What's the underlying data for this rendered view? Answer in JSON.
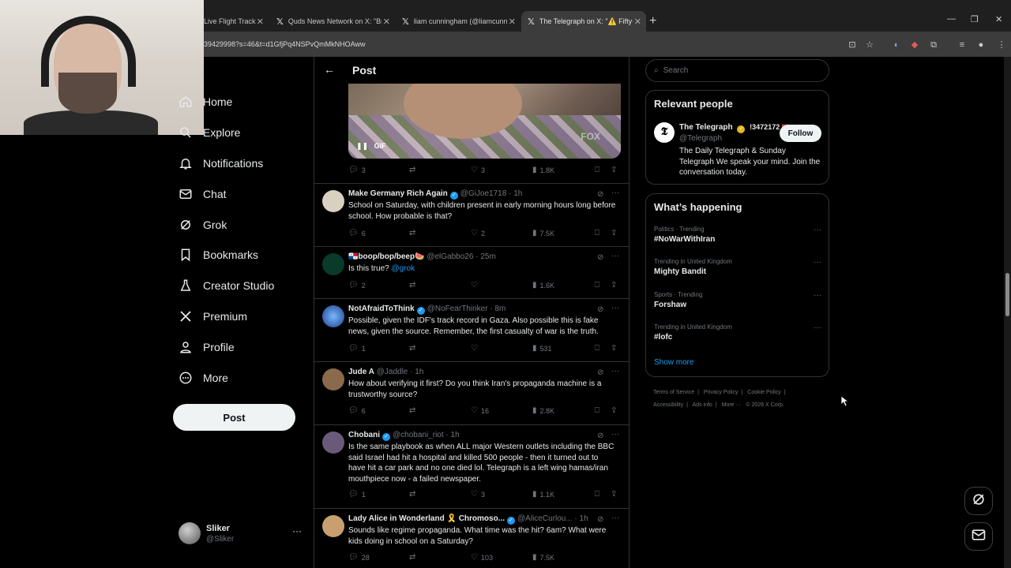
{
  "browser": {
    "tabs": [
      {
        "label": "Live Flight Track",
        "active": false
      },
      {
        "label": "Quds News Network on X: \"Bre",
        "active": false
      },
      {
        "label": "liam cunningham (@liamcunni",
        "active": false
      },
      {
        "label": "The Telegraph on X: \"⚠️ Fifty-o",
        "active": true
      }
    ],
    "url": "39429998?s=46&t=d1GfjPq4NSPvQmMkNHOAww"
  },
  "nav": {
    "items": [
      {
        "label": "Home",
        "icon": "home-icon"
      },
      {
        "label": "Explore",
        "icon": "search-icon"
      },
      {
        "label": "Notifications",
        "icon": "bell-icon"
      },
      {
        "label": "Chat",
        "icon": "mail-icon"
      },
      {
        "label": "Grok",
        "icon": "grok-icon"
      },
      {
        "label": "Bookmarks",
        "icon": "bookmark-icon"
      },
      {
        "label": "Creator Studio",
        "icon": "flask-icon"
      },
      {
        "label": "Premium",
        "icon": "x-logo-icon"
      },
      {
        "label": "Profile",
        "icon": "person-icon"
      },
      {
        "label": "More",
        "icon": "more-circle-icon"
      }
    ],
    "post_label": "Post"
  },
  "account": {
    "name": "Sliker",
    "handle": "@Sliker"
  },
  "center": {
    "header_title": "Post",
    "gif_badge": "GIF",
    "gif_watermark": "FOX",
    "gif_actions": {
      "replies": "3",
      "likes": "3",
      "views": "1.8K"
    },
    "tweets": [
      {
        "name": "Make Germany Rich Again",
        "verified": true,
        "handle": "@GiJoe1718",
        "time": "1h",
        "text": "School on Saturday, with children present in early morning hours long before school. How probable is that?",
        "replies": "6",
        "likes": "2",
        "views": "7.5K",
        "avatar": "#d8d0c0"
      },
      {
        "name": "🇵🇦boop/bop/beep🍉",
        "verified": false,
        "handle": "@elGabbo26",
        "time": "25m",
        "text": "Is this true? ",
        "mention": "@grok",
        "replies": "2",
        "likes": "",
        "views": "1.6K",
        "avatar": "#0a3a2a"
      },
      {
        "name": "NotAfraidToThink",
        "verified": true,
        "handle": "@NoFearThinker",
        "time": "8m",
        "text": "Possible, given the IDF's track record in Gaza. Also possible this is fake news, given the source. Remember, the first casualty of war is the truth.",
        "replies": "1",
        "likes": "",
        "views": "531",
        "avatar": "#2a6fd0"
      },
      {
        "name": "Jude A",
        "verified": false,
        "handle": "@Jaddle",
        "time": "1h",
        "text": "How about verifying it first? Do you think Iran's propaganda machine is a trustworthy source?",
        "replies": "6",
        "likes": "16",
        "views": "2.8K",
        "avatar": "#8a6a4a"
      },
      {
        "name": "Chobani",
        "verified": true,
        "handle": "@chobani_riot",
        "time": "1h",
        "text": "Is the same playbook as when ALL major Western outlets including the BBC said Israel had hit a hospital and killed 500 people - then it turned out to have hit a car park and no one died lol. Telegraph is a left wing hamas/iran mouthpiece now - a failed newspaper.",
        "replies": "1",
        "likes": "3",
        "views": "1.1K",
        "avatar": "#6a5a7a"
      },
      {
        "name": "Lady Alice in Wonderland 🎗️ Chromoso...",
        "verified": true,
        "handle": "@AliceCurlou...",
        "time": "1h",
        "text": "Sounds like regime propaganda. What time was the hit?  6am? What were kids doing in school on a Saturday?",
        "replies": "28",
        "likes": "103",
        "views": "7.5K",
        "avatar": "#c8a070"
      }
    ]
  },
  "right": {
    "search_placeholder": "Search",
    "relevant_title": "Relevant people",
    "person": {
      "name": "The Telegraph",
      "handle": "@Telegraph",
      "follow_label": "Follow",
      "bio": "The Daily Telegraph & Sunday Telegraph We speak your mind. Join the conversation today.",
      "overlay_text": "!3472172"
    },
    "happening_title": "What’s happening",
    "trends": [
      {
        "context": "Politics · Trending",
        "name": "#NoWarWithIran"
      },
      {
        "context": "Trending in United Kingdom",
        "name": "Mighty Bandit"
      },
      {
        "context": "Sports · Trending",
        "name": "Forshaw"
      },
      {
        "context": "Trending in United Kingdom",
        "name": "#lofc"
      }
    ],
    "show_more": "Show more",
    "footer": [
      "Terms of Service",
      "Privacy Policy",
      "Cookie Policy",
      "Accessibility",
      "Ads info",
      "More ···",
      "© 2026 X Corp."
    ]
  },
  "colors": {
    "accent": "#1d9bf0",
    "bg": "#000000",
    "border": "#2f3336",
    "muted": "#71767b"
  }
}
